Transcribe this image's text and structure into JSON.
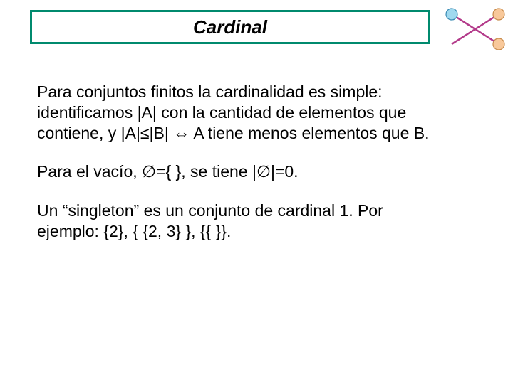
{
  "title": "Cardinal",
  "paragraphs": {
    "p1": "Para conjuntos finitos la cardinalidad es simple: identificamos |A| con la cantidad de elementos que contiene, y |A|≤|B| ⇔ A tiene menos elementos que B.",
    "p2": "Para el vacío, ∅={ }, se tiene |∅|=0.",
    "p3": "Un “singleton” es un conjunto de cardinal 1. Por ejemplo: {2}, { {2, 3} }, {{ }}."
  }
}
